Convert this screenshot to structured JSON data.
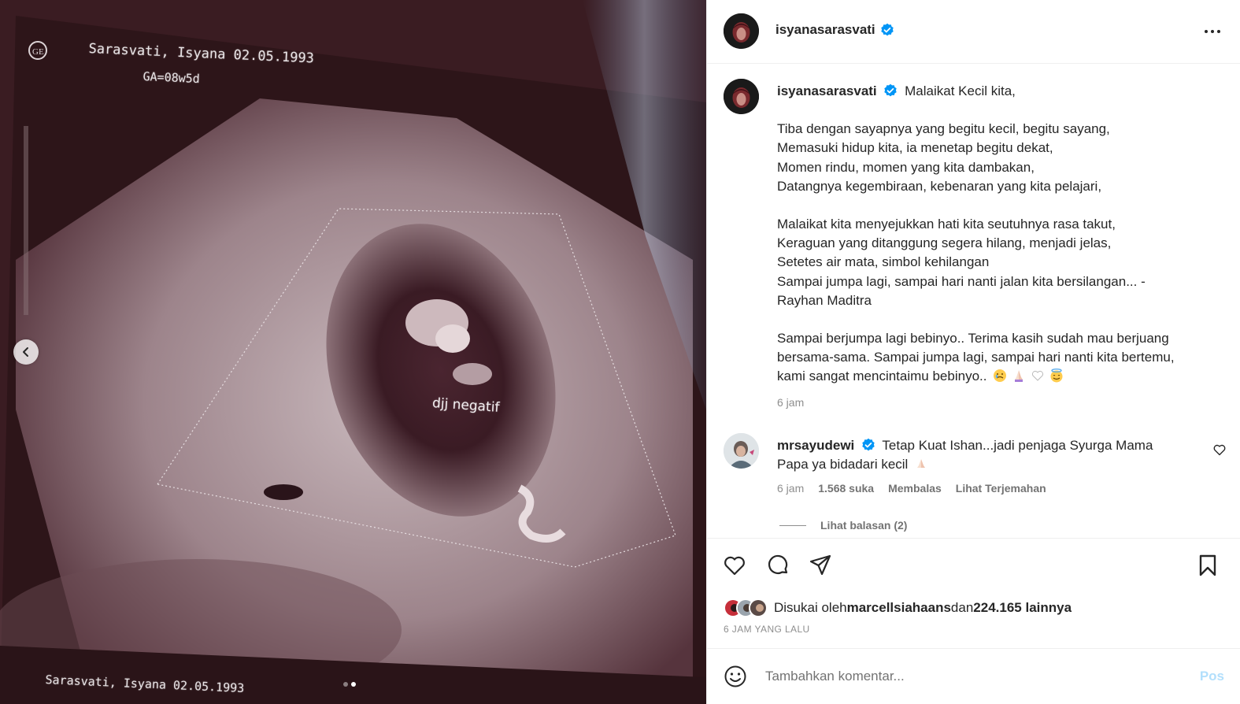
{
  "media": {
    "overlay_name_date": "Sarasvati, Isyana  02.05.1993",
    "overlay_ga": "GA=08w5d",
    "overlay_annotation": "djj negatif",
    "overlay_bottom": "Sarasvati, Isyana  02.05.1993",
    "carousel_count": 2,
    "carousel_active": 2
  },
  "header": {
    "username": "isyanasarasvati",
    "verified": true
  },
  "caption": {
    "username": "isyanasarasvati",
    "first_line": "Malaikat Kecil kita,",
    "stanza1": "Tiba dengan sayapnya yang begitu kecil, begitu sayang,\nMemasuki hidup kita, ia menetap begitu dekat,\nMomen rindu, momen yang kita dambakan,\nDatangnya kegembiraan, kebenaran yang kita pelajari,",
    "stanza2": "Malaikat kita menyejukkan hati kita seutuhnya rasa takut,\nKeraguan yang ditanggung segera hilang, menjadi jelas,\nSetetes air mata, simbol kehilangan\nSampai jumpa lagi, sampai hari nanti jalan kita bersilangan... -\nRayhan Maditra",
    "stanza3": "Sampai berjumpa lagi bebinyo.. Terima kasih sudah mau berjuang bersama-sama. Sampai jumpa lagi, sampai hari nanti kita bertemu, kami sangat mencintaimu bebinyo..",
    "emojis": [
      "crying-face",
      "folded-hands",
      "white-heart",
      "smiling-face-with-halo"
    ],
    "time": "6 jam"
  },
  "comment": {
    "username": "mrsayudewi",
    "verified": true,
    "text": "Tetap Kuat Ishan...jadi penjaga Syurga Mama Papa ya bidadari kecil",
    "emoji": "folded-hands",
    "time": "6 jam",
    "likes": "1.568 suka",
    "reply_label": "Membalas",
    "translate_label": "Lihat Terjemahan",
    "view_replies": "Lihat balasan (2)"
  },
  "likes": {
    "prefix": "Disukai oleh ",
    "user": "marcellsiahaans",
    "middle": " dan ",
    "count": "224.165 lainnya"
  },
  "time_ago": "6 JAM YANG LALU",
  "add_comment": {
    "placeholder": "Tambahkan komentar...",
    "post_label": "Pos"
  },
  "icons": {
    "like": "heart-icon",
    "comment": "comment-icon",
    "share": "send-icon",
    "save": "bookmark-icon",
    "emoji": "emoji-icon",
    "more": "more-icon",
    "prev": "chevron-left-icon"
  },
  "colors": {
    "verified": "#0095f6",
    "post_disabled": "#b2dffc",
    "secondary_text": "#8e8e8e"
  }
}
